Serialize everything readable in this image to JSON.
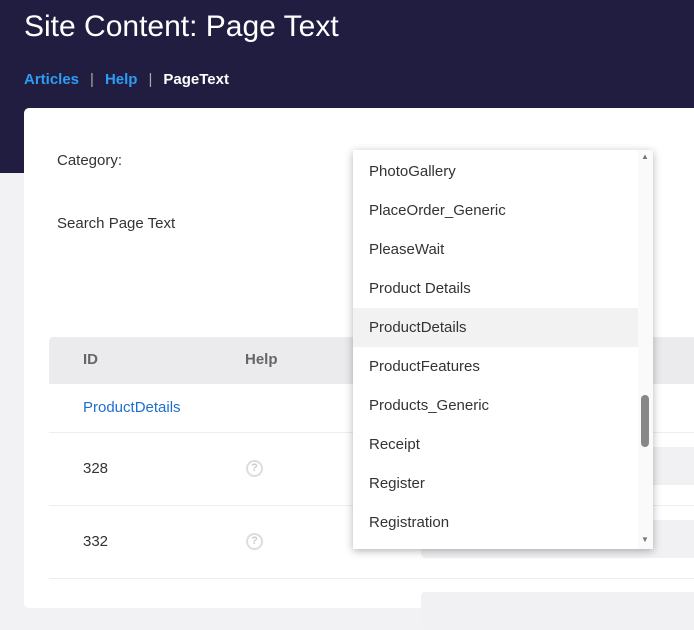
{
  "header": {
    "title": "Site Content: Page Text",
    "breadcrumbs": [
      "Articles",
      "Help",
      "PageText"
    ],
    "separator": "|"
  },
  "form": {
    "category_label": "Category:",
    "search_label": "Search Page Text"
  },
  "table": {
    "columns": [
      "ID",
      "Help"
    ],
    "group": "ProductDetails",
    "rows": [
      {
        "id": "328"
      },
      {
        "id": "332"
      }
    ],
    "help_icon": "?"
  },
  "dropdown": {
    "options": [
      "PhotoGallery",
      "PlaceOrder_Generic",
      "PleaseWait",
      "Product Details",
      "ProductDetails",
      "ProductFeatures",
      "Products_Generic",
      "Receipt",
      "Register",
      "Registration"
    ],
    "highlighted": "ProductDetails"
  }
}
